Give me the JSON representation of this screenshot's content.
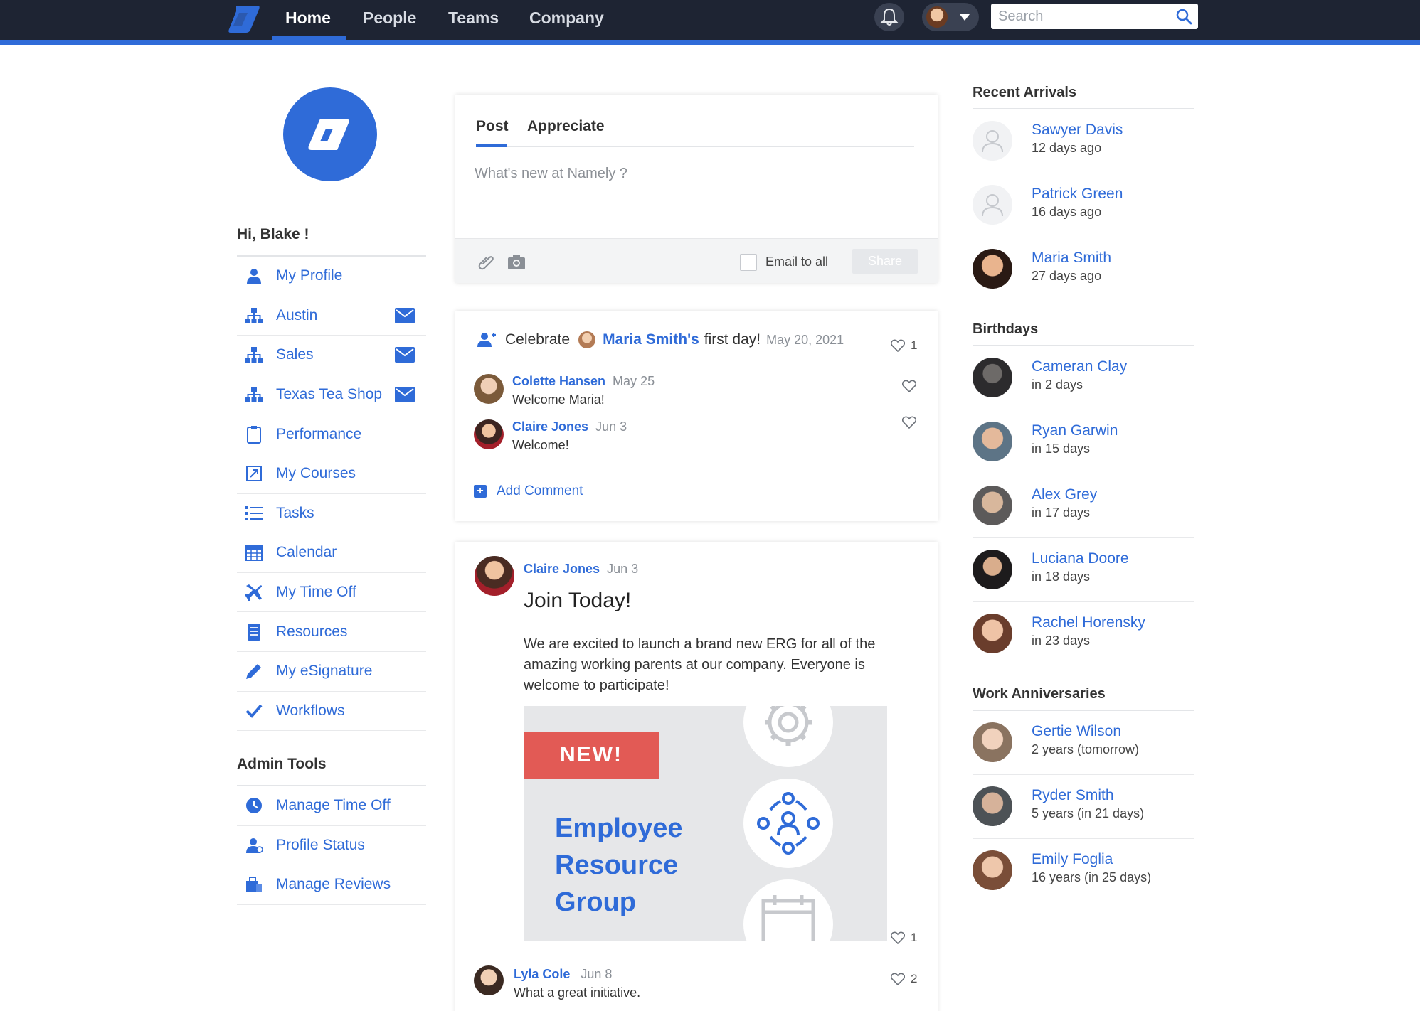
{
  "nav": {
    "tabs": [
      {
        "label": "Home",
        "active": true
      },
      {
        "label": "People"
      },
      {
        "label": "Teams"
      },
      {
        "label": "Company"
      }
    ],
    "search_placeholder": "Search"
  },
  "sidebar": {
    "greeting": "Hi, Blake !",
    "items": [
      {
        "label": "My Profile",
        "icon": "user-icon"
      },
      {
        "label": "Austin",
        "icon": "org-chart-icon",
        "mail": true
      },
      {
        "label": "Sales",
        "icon": "org-chart-icon",
        "mail": true
      },
      {
        "label": "Texas Tea Shop",
        "icon": "org-chart-icon",
        "mail": true
      },
      {
        "label": "Performance",
        "icon": "clipboard-icon"
      },
      {
        "label": "My Courses",
        "icon": "courses-icon"
      },
      {
        "label": "Tasks",
        "icon": "list-icon"
      },
      {
        "label": "Calendar",
        "icon": "calendar-icon"
      },
      {
        "label": "My Time Off",
        "icon": "airplane-icon"
      },
      {
        "label": "Resources",
        "icon": "book-icon"
      },
      {
        "label": "My eSignature",
        "icon": "pencil-icon"
      },
      {
        "label": "Workflows",
        "icon": "checkmark-icon"
      }
    ],
    "admin_title": "Admin Tools",
    "admin_items": [
      {
        "label": "Manage Time Off",
        "icon": "clock-icon"
      },
      {
        "label": "Profile Status",
        "icon": "profile-status-icon"
      },
      {
        "label": "Manage Reviews",
        "icon": "reviews-icon"
      }
    ]
  },
  "composer": {
    "tabs": [
      "Post",
      "Appreciate"
    ],
    "placeholder": "What's new at Namely ?",
    "email_label": "Email to all",
    "share_label": "Share"
  },
  "celebrate": {
    "word": "Celebrate",
    "name": "Maria Smith's",
    "suffix": "first day!",
    "date": "May 20, 2021",
    "likes": "1",
    "comments": [
      {
        "name": "Colette Hansen",
        "date": "May 25",
        "text": "Welcome Maria!"
      },
      {
        "name": "Claire Jones",
        "date": "Jun 3",
        "text": "Welcome!"
      }
    ],
    "add_comment": "Add Comment"
  },
  "post": {
    "author": "Claire Jones",
    "date": "Jun 3",
    "title": "Join Today!",
    "body": "We are excited to launch a brand new ERG for all of the amazing working parents at our company. Everyone is welcome to participate!",
    "image_badge": "NEW!",
    "image_lines": [
      "Employee",
      "Resource",
      "Group"
    ],
    "likes": "1",
    "comment": {
      "name": "Lyla Cole",
      "date": "Jun 8",
      "text": "What a great initiative.",
      "likes": "2"
    }
  },
  "recent_arrivals": {
    "title": "Recent Arrivals",
    "people": [
      {
        "name": "Sawyer Davis",
        "sub": "12 days ago"
      },
      {
        "name": "Patrick Green",
        "sub": "16 days ago"
      },
      {
        "name": "Maria Smith",
        "sub": "27 days ago"
      }
    ]
  },
  "birthdays": {
    "title": "Birthdays",
    "people": [
      {
        "name": "Cameran Clay",
        "sub": "in 2 days"
      },
      {
        "name": "Ryan Garwin",
        "sub": "in 15 days"
      },
      {
        "name": "Alex Grey",
        "sub": "in 17 days"
      },
      {
        "name": "Luciana Doore",
        "sub": "in 18 days"
      },
      {
        "name": "Rachel Horensky",
        "sub": "in 23 days"
      }
    ]
  },
  "anniversaries": {
    "title": "Work Anniversaries",
    "people": [
      {
        "name": "Gertie Wilson",
        "sub": "2 years (tomorrow)"
      },
      {
        "name": "Ryder Smith",
        "sub": "5 years (in 21 days)"
      },
      {
        "name": "Emily Foglia",
        "sub": "16 years (in 25 days)"
      }
    ]
  },
  "colors": {
    "accent": "#2f6bd8",
    "nav_bg": "#1e2433",
    "badge_red": "#e25a55"
  }
}
